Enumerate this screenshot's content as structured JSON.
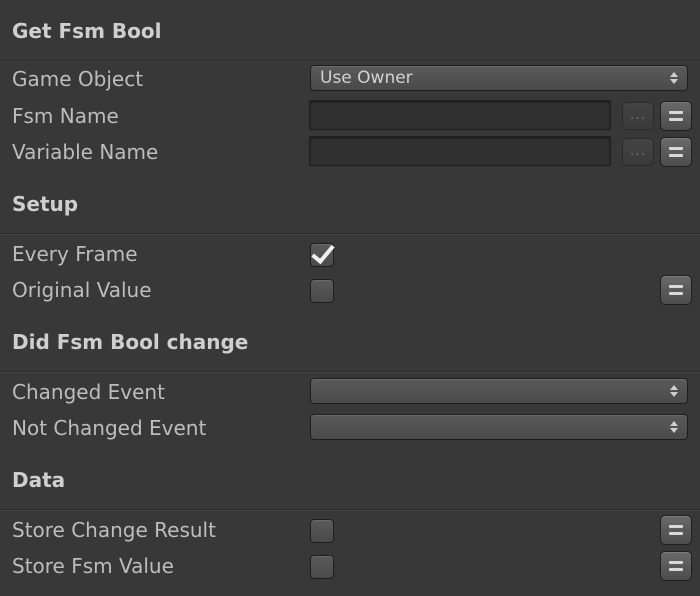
{
  "sections": {
    "get_fsm_bool": {
      "title": "Get Fsm Bool",
      "game_object": {
        "label": "Game Object",
        "value": "Use Owner"
      },
      "fsm_name": {
        "label": "Fsm Name",
        "value": ""
      },
      "variable_name": {
        "label": "Variable Name",
        "value": ""
      }
    },
    "setup": {
      "title": "Setup",
      "every_frame": {
        "label": "Every Frame",
        "checked": true
      },
      "original_value": {
        "label": "Original Value",
        "checked": false
      }
    },
    "did_change": {
      "title": "Did Fsm Bool change",
      "changed_event": {
        "label": "Changed Event",
        "value": ""
      },
      "not_changed_event": {
        "label": "Not Changed Event",
        "value": ""
      }
    },
    "data": {
      "title": "Data",
      "store_change_result": {
        "label": "Store Change Result",
        "checked": false
      },
      "store_fsm_value": {
        "label": "Store Fsm Value",
        "checked": false
      }
    }
  },
  "icons": {
    "browse": "ellipsis-icon",
    "variable_toggle": "equals-icon",
    "dropdown_arrows": "up-down-arrows-icon",
    "check": "checkmark-icon"
  },
  "buttons": {
    "browse_label": "..."
  },
  "colors": {
    "background": "#383838",
    "header_text": "#cfcfcf",
    "label_text": "#bdbdbd"
  }
}
